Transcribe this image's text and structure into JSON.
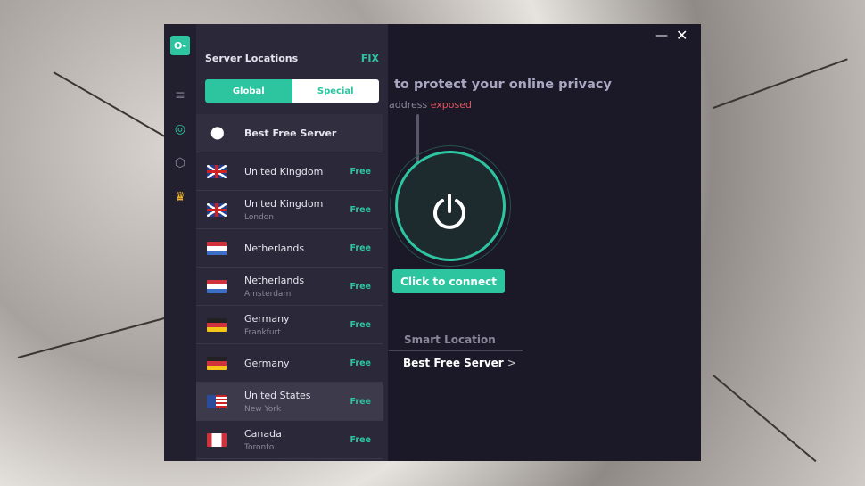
{
  "window": {
    "minimize_icon": "minimize-icon",
    "close_icon": "close-icon"
  },
  "rail": {
    "logo": "O-",
    "icons": [
      "menu-icon",
      "globe-icon",
      "settings-icon",
      "crown-icon"
    ]
  },
  "panel": {
    "title": "Server Locations",
    "fix": "FIX",
    "tabs": [
      "Global",
      "Special"
    ],
    "active_tab": "Global",
    "best": "Best Free Server",
    "servers": [
      {
        "name": "United Kingdom",
        "city": "",
        "badge": "Free",
        "flag": "uk"
      },
      {
        "name": "United Kingdom",
        "city": "London",
        "badge": "Free",
        "flag": "uk"
      },
      {
        "name": "Netherlands",
        "city": "",
        "badge": "Free",
        "flag": "nl"
      },
      {
        "name": "Netherlands",
        "city": "Amsterdam",
        "badge": "Free",
        "flag": "nl"
      },
      {
        "name": "Germany",
        "city": "Frankfurt",
        "badge": "Free",
        "flag": "de"
      },
      {
        "name": "Germany",
        "city": "",
        "badge": "Free",
        "flag": "de"
      },
      {
        "name": "United States",
        "city": "New York",
        "badge": "Free",
        "flag": "us",
        "selected": true
      },
      {
        "name": "Canada",
        "city": "Toronto",
        "badge": "Free",
        "flag": "ca"
      }
    ]
  },
  "main": {
    "title": "to protect your online privacy",
    "sub_prefix": "address",
    "sub_status": "exposed",
    "connect": "Click to connect",
    "smart_label": "Smart Location",
    "smart_value": "Best Free Server",
    "chevron": ">"
  },
  "colors": {
    "accent": "#2cc5a0",
    "danger": "#e05561",
    "bg": "#1b1927"
  }
}
